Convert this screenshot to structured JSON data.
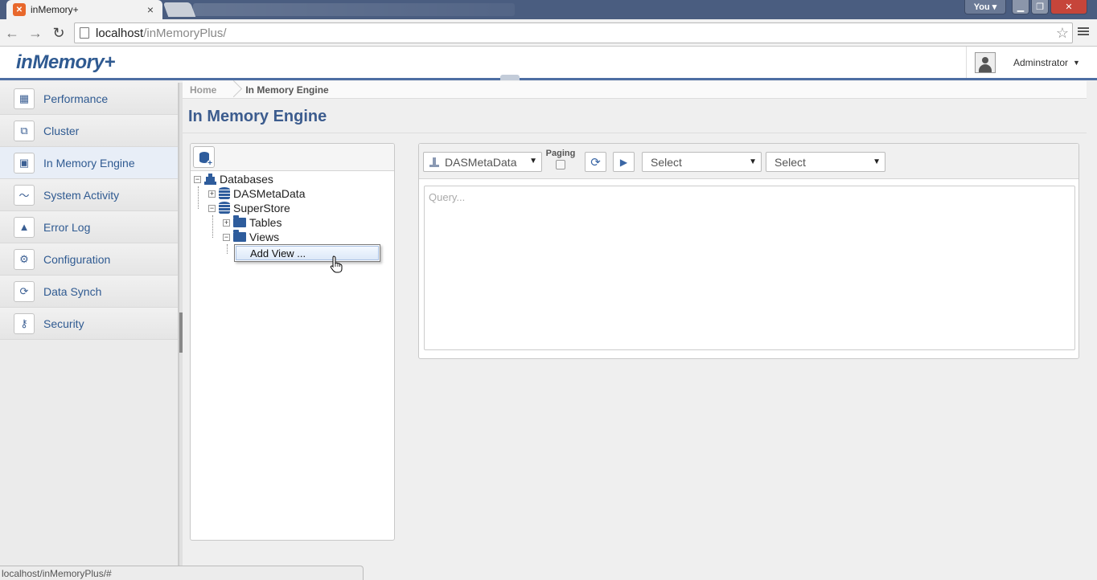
{
  "browser": {
    "tab_title": "inMemory+",
    "tab_favicon": "✕",
    "profile": "You",
    "url_host": "localhost",
    "url_path": "/inMemoryPlus/",
    "status_url": "localhost/inMemoryPlus/#"
  },
  "header": {
    "logo": "inMemory+",
    "user_name": "Adminstrator"
  },
  "sidebar": {
    "items": [
      {
        "label": "Performance",
        "icon": "performance-icon",
        "glyph": "▦"
      },
      {
        "label": "Cluster",
        "icon": "cluster-icon",
        "glyph": "⧉"
      },
      {
        "label": "In Memory Engine",
        "icon": "engine-icon",
        "glyph": "▣",
        "active": true
      },
      {
        "label": "System Activity",
        "icon": "activity-icon",
        "glyph": "〜"
      },
      {
        "label": "Error Log",
        "icon": "warning-icon",
        "glyph": "▲"
      },
      {
        "label": "Configuration",
        "icon": "gear-icon",
        "glyph": "⚙"
      },
      {
        "label": "Data Synch",
        "icon": "sync-icon",
        "glyph": "⟳"
      },
      {
        "label": "Security",
        "icon": "key-icon",
        "glyph": "⚷"
      }
    ]
  },
  "breadcrumb": {
    "home": "Home",
    "current": "In Memory Engine"
  },
  "page": {
    "title": "In Memory Engine"
  },
  "tree": {
    "root": "Databases",
    "db1": "DASMetaData",
    "db2": "SuperStore",
    "tables": "Tables",
    "views": "Views",
    "context_menu_item": "Add View ..."
  },
  "query": {
    "database_select": "DASMetaData",
    "paging_label": "Paging",
    "select1": "Select",
    "select2": "Select",
    "placeholder": "Query..."
  },
  "colors": {
    "brand": "#2f5a91",
    "header_border": "#4d6ea3",
    "tree_icon": "#2e5c9c"
  }
}
